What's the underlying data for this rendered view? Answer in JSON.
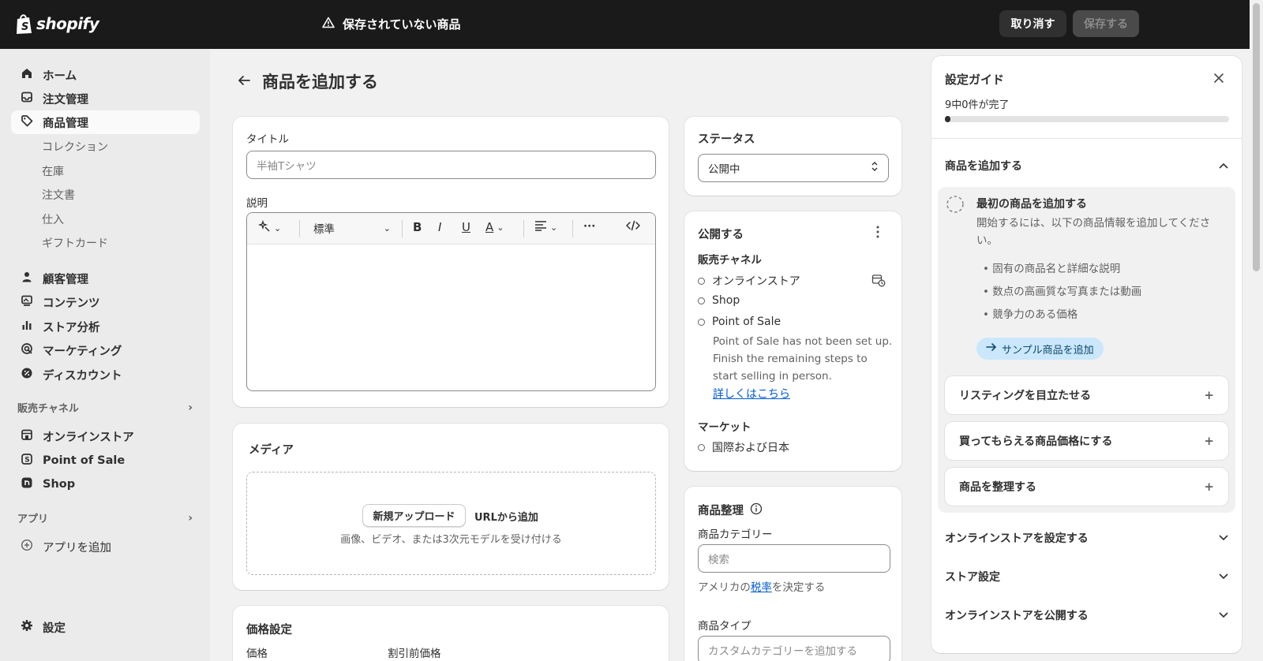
{
  "topbar": {
    "logo_text": "shopify",
    "unsaved_text": "保存されていない商品",
    "discard_label": "取り消す",
    "save_label": "保存する"
  },
  "sidebar": {
    "items": [
      {
        "label": "ホーム",
        "icon": "home-icon"
      },
      {
        "label": "注文管理",
        "icon": "inbox-icon"
      },
      {
        "label": "商品管理",
        "icon": "tag-icon",
        "active": true
      }
    ],
    "product_subitems": [
      "コレクション",
      "在庫",
      "注文書",
      "仕入",
      "ギフトカード"
    ],
    "items2": [
      {
        "label": "顧客管理",
        "icon": "person-icon"
      },
      {
        "label": "コンテンツ",
        "icon": "image-icon"
      },
      {
        "label": "ストア分析",
        "icon": "bar-chart-icon"
      },
      {
        "label": "マーケティング",
        "icon": "target-icon"
      },
      {
        "label": "ディスカウント",
        "icon": "discount-icon"
      }
    ],
    "sales_channels_label": "販売チャネル",
    "channels": [
      {
        "label": "オンラインストア",
        "icon": "store-icon"
      },
      {
        "label": "Point of Sale",
        "icon": "pos-icon"
      },
      {
        "label": "Shop",
        "icon": "shop-icon"
      }
    ],
    "apps_label": "アプリ",
    "add_app_label": "アプリを追加",
    "settings_label": "設定"
  },
  "page": {
    "title": "商品を追加する"
  },
  "product_form": {
    "title_label": "タイトル",
    "title_placeholder": "半袖Tシャツ",
    "description_label": "説明",
    "format_select": "標準",
    "media_title": "メディア",
    "upload_label": "新規アップロード",
    "url_label": "URLから追加",
    "media_hint": "画像、ビデオ、または3次元モデルを受け付ける",
    "pricing_title": "価格設定",
    "price_label": "価格",
    "compare_price_label": "割引前価格"
  },
  "status_card": {
    "title": "ステータス",
    "value": "公開中"
  },
  "publish_card": {
    "title": "公開する",
    "sales_channels_label": "販売チャネル",
    "channels": [
      "オンラインストア",
      "Shop",
      "Point of Sale"
    ],
    "pos_note": "Point of Sale has not been set up. Finish the remaining steps to start selling in person.",
    "learn_more": "詳しくはこちら",
    "markets_label": "マーケット",
    "market": "国際および日本"
  },
  "organize_card": {
    "title": "商品整理",
    "category_label": "商品カテゴリー",
    "category_placeholder": "検索",
    "tax_prefix": "アメリカの",
    "tax_link": "税率",
    "tax_suffix": "を決定する",
    "type_label": "商品タイプ",
    "type_placeholder": "カスタムカテゴリーを追加する"
  },
  "setup_guide": {
    "title": "設定ガイド",
    "progress_text": "9中0件が完了",
    "progress": 0.02,
    "section_title": "商品を追加する",
    "first_step_title": "最初の商品を追加する",
    "first_step_desc": "開始するには、以下の商品情報を追加してください。",
    "bullets": [
      "固有の商品名と詳細な説明",
      "数点の高画質な写真または動画",
      "競争力のある価格"
    ],
    "sample_button": "サンプル商品を追加",
    "steps": [
      "リスティングを目立たせる",
      "買ってもらえる商品価格にする",
      "商品を整理する"
    ],
    "sections": [
      "オンラインストアを設定する",
      "ストア設定",
      "オンラインストアを公開する"
    ]
  }
}
